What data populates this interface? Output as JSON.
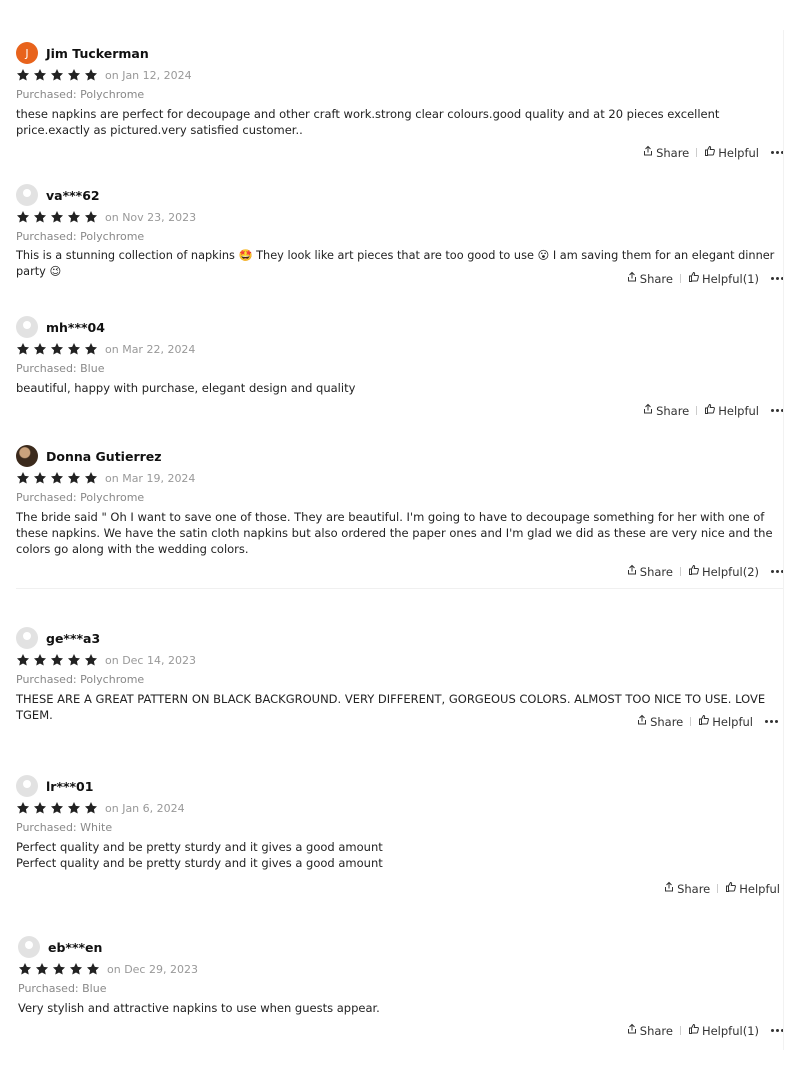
{
  "colors": {
    "star": "#222222",
    "accent_avatar": "#e8631c",
    "muted": "#999999"
  },
  "icons": {
    "star": "star-icon",
    "share": "share-icon",
    "helpful": "thumbs-up-icon",
    "more": "more-dots-icon"
  },
  "reviews": [
    {
      "initial": "J",
      "name": "Jim Tuckerman",
      "stars": 5,
      "date": "on Jan 12, 2024",
      "purchased": "Purchased: Polychrome",
      "text": "these napkins are perfect for decoupage and other craft work.strong clear colours.good quality and at 20 pieces excellent price.exactly as pictured.very satisfied customer..",
      "share": "Share",
      "helpful": "Helpful"
    },
    {
      "initial": "",
      "name": "va***62",
      "stars": 5,
      "date": "on Nov 23, 2023",
      "purchased": "Purchased: Polychrome",
      "text": "This is a stunning collection of napkins 🤩 They look like art pieces that are too good to use 😮 I am saving them for an elegant dinner party 😉",
      "share": "Share",
      "helpful": "Helpful(1)"
    },
    {
      "initial": "",
      "name": "mh***04",
      "stars": 5,
      "date": "on Mar 22, 2024",
      "purchased": "Purchased: Blue",
      "text": "beautiful, happy with purchase, elegant design and quality",
      "share": "Share",
      "helpful": "Helpful"
    },
    {
      "initial": "",
      "name": "Donna Gutierrez",
      "stars": 5,
      "date": "on Mar 19, 2024",
      "purchased": "Purchased: Polychrome",
      "text": "The bride said \" Oh I want to save one of those. They are beautiful. I'm going to have to decoupage something for her with one of these napkins. We have the satin cloth napkins but also ordered the paper ones and I'm glad we did as these are very nice and the colors go along with the wedding colors.",
      "share": "Share",
      "helpful": "Helpful(2)"
    },
    {
      "initial": "",
      "name": "ge***a3",
      "stars": 5,
      "date": "on Dec 14, 2023",
      "purchased": "Purchased: Polychrome",
      "text": "THESE ARE A GREAT PATTERN ON BLACK BACKGROUND. VERY DIFFERENT, GORGEOUS COLORS. ALMOST TOO NICE TO USE. LOVE TGEM.",
      "share": "Share",
      "helpful": "Helpful"
    },
    {
      "initial": "",
      "name": "lr***01",
      "stars": 5,
      "date": "on Jan 6, 2024",
      "purchased": "Purchased: White",
      "text": "Perfect quality and be pretty sturdy and it gives a good amount\nPerfect quality and be pretty sturdy and it gives a good amount",
      "share": "Share",
      "helpful": "Helpful"
    },
    {
      "initial": "",
      "name": "eb***en",
      "stars": 5,
      "date": "on Dec 29, 2023",
      "purchased": "Purchased: Blue",
      "text": "Very stylish and attractive napkins to use when guests appear.",
      "share": "Share",
      "helpful": "Helpful(1)"
    }
  ]
}
